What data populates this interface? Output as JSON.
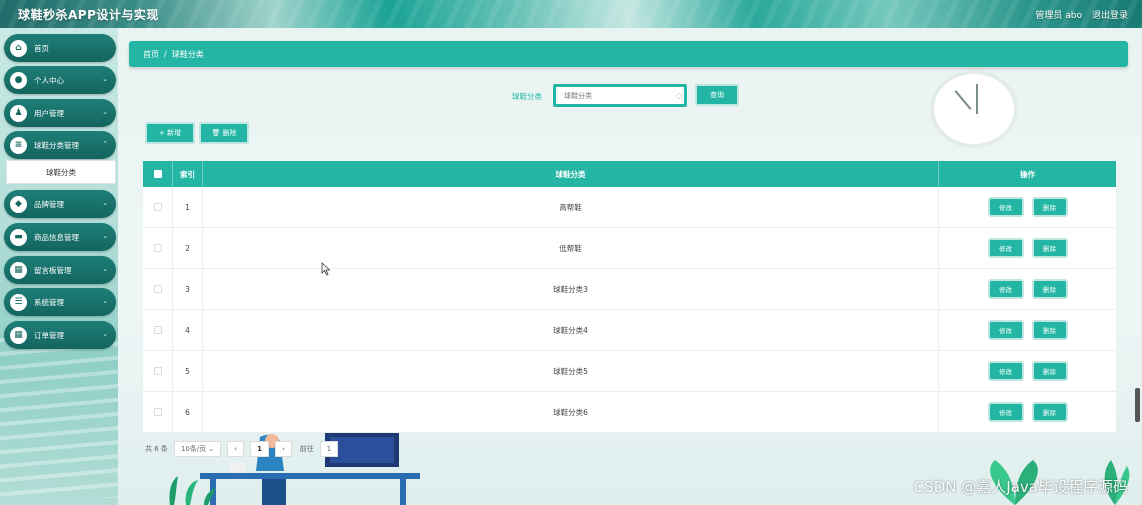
{
  "header": {
    "app_title": "球鞋秒杀APP设计与实现",
    "admin_label": "管理员 abo",
    "logout_label": "退出登录"
  },
  "sidebar": {
    "items": [
      {
        "label": "首页",
        "icon": "home-icon",
        "has_arrow": false
      },
      {
        "label": "个人中心",
        "icon": "user-icon",
        "has_arrow": true
      },
      {
        "label": "用户管理",
        "icon": "users-icon",
        "has_arrow": true
      },
      {
        "label": "球鞋分类管理",
        "icon": "list-icon",
        "has_arrow": true
      },
      {
        "label": "品牌管理",
        "icon": "tag-icon",
        "has_arrow": true
      },
      {
        "label": "商品信息管理",
        "icon": "box-icon",
        "has_arrow": true
      },
      {
        "label": "留言板管理",
        "icon": "grid-icon",
        "has_arrow": true
      },
      {
        "label": "系统管理",
        "icon": "settings-icon",
        "has_arrow": true
      },
      {
        "label": "订单管理",
        "icon": "grid-icon",
        "has_arrow": true
      }
    ],
    "active_submenu": "球鞋分类"
  },
  "breadcrumb": {
    "home": "首页",
    "separator": "/",
    "current": "球鞋分类"
  },
  "search": {
    "label": "球鞋分类",
    "placeholder": "球鞋分类",
    "button": "查询"
  },
  "toolbar": {
    "add_label": "+ 新增",
    "delete_label": "🗑 删除"
  },
  "table": {
    "columns": [
      "索引",
      "球鞋分类",
      "操作"
    ],
    "rows": [
      {
        "index": "1",
        "name": "高帮鞋"
      },
      {
        "index": "2",
        "name": "低帮鞋"
      },
      {
        "index": "3",
        "name": "球鞋分类3"
      },
      {
        "index": "4",
        "name": "球鞋分类4"
      },
      {
        "index": "5",
        "name": "球鞋分类5"
      },
      {
        "index": "6",
        "name": "球鞋分类6"
      }
    ],
    "edit_label": "修改",
    "delete_label": "删除"
  },
  "pagination": {
    "total": "共 6 条",
    "page_size": "10条/页",
    "current_page": "1",
    "goto_label": "前往",
    "goto_value": "1"
  },
  "watermark": "CSDN @嘉人Java毕设程序源码",
  "colors": {
    "accent": "#23b6a4",
    "sidebar_item": "#1a746d"
  }
}
